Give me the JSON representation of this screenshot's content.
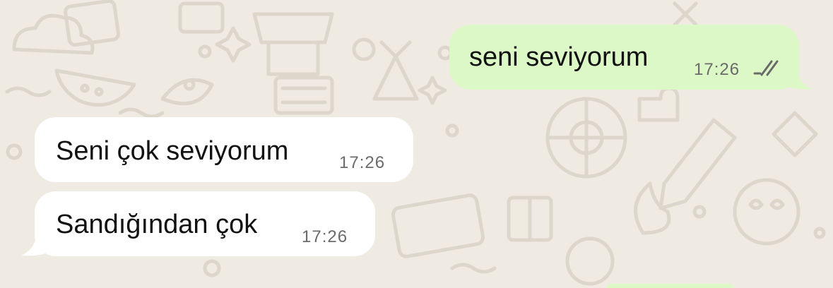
{
  "wallpaper": {
    "color": "#efeae2",
    "doodle_color": "#ddd6cb"
  },
  "messages": [
    {
      "direction": "outgoing",
      "text": "seni seviyorum",
      "time": "17:26",
      "status": "read",
      "status_icon": "double-check-icon",
      "bubble_color": "#dcf8c6"
    },
    {
      "direction": "incoming",
      "text": "Seni çok seviyorum",
      "time": "17:26",
      "bubble_color": "#ffffff"
    },
    {
      "direction": "incoming",
      "text": "Sandığından çok",
      "time": "17:26",
      "bubble_color": "#ffffff"
    }
  ]
}
